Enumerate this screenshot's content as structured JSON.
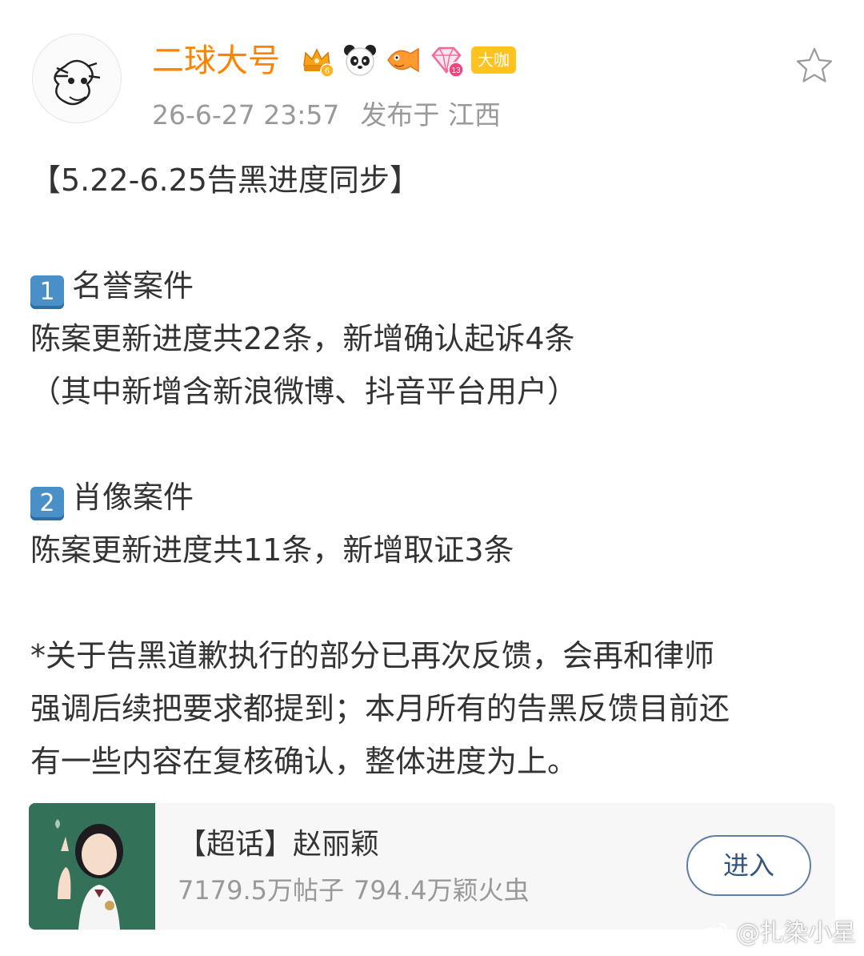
{
  "header": {
    "username": "二球大号",
    "badges": [
      "crown-level-6-badge",
      "panda-badge",
      "fish-badge",
      "diamond-level-13-badge"
    ],
    "vip_label": "大咖",
    "time": "26-6-27 23:57",
    "location": "发布于 江西"
  },
  "post": {
    "title": "【5.22-6.25告黑进度同步】",
    "section1": {
      "key": "1",
      "heading": "名誉案件",
      "line1": "陈案更新进度共22条，新增确认起诉4条",
      "line2": "（其中新增含新浪微博、抖音平台用户）"
    },
    "section2": {
      "key": "2",
      "heading": "肖像案件",
      "line1": "陈案更新进度共11条，新增取证3条"
    },
    "note": {
      "line1": "*关于告黑道歉执行的部分已再次反馈，会再和律师",
      "line2": "强调后续把要求都提到；本月所有的告黑反馈目前还",
      "line3": "有一些内容在复核确认，整体进度为上。"
    }
  },
  "card": {
    "title": "【超话】赵丽颖",
    "posts": "7179.5万帖子",
    "fans": "794.4万颖火虫",
    "button": "进入"
  },
  "watermark": "@扎染小星",
  "colors": {
    "username": "#ff8200",
    "meta": "#999999",
    "button_border": "#5f7ea3",
    "vip": "#ffc21f"
  }
}
